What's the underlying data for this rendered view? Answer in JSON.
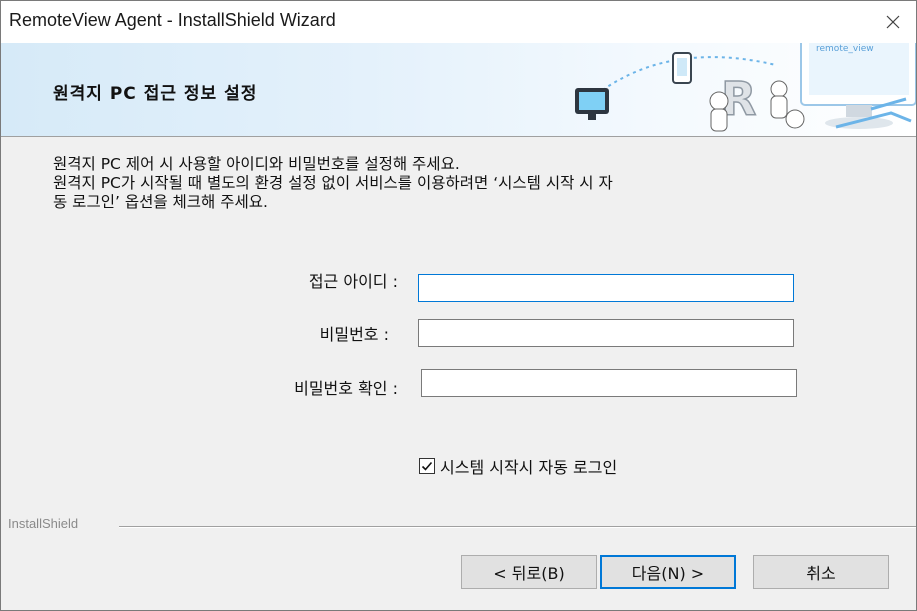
{
  "window": {
    "title": "RemoteView Agent - InstallShield Wizard",
    "close_icon": "close-icon"
  },
  "header": {
    "title": "원격지 PC 접근 정보 설정",
    "art_text": "remote_view"
  },
  "description": {
    "line1": "원격지 PC 제어 시 사용할 아이디와 비밀번호를 설정해 주세요.",
    "line2": "원격지 PC가 시작될 때 별도의 환경 설정 없이 서비스를 이용하려면 ‘시스템 시작 시 자",
    "line3": "동 로그인’ 옵션을 체크해 주세요."
  },
  "form": {
    "id_label": "접근 아이디 :",
    "id_value": "",
    "password_label": "비밀번호 :",
    "password_value": "",
    "confirm_label": "비밀번호 확인 :",
    "confirm_value": ""
  },
  "checkbox": {
    "label": "시스템 시작시 자동 로그인",
    "checked": true
  },
  "footer": {
    "brand": "InstallShield",
    "back_label": "< 뒤로(B)",
    "next_label": "다음(N) >",
    "cancel_label": "취소"
  },
  "colors": {
    "accent": "#0078d7",
    "header_bg": "#d6eaf8"
  }
}
